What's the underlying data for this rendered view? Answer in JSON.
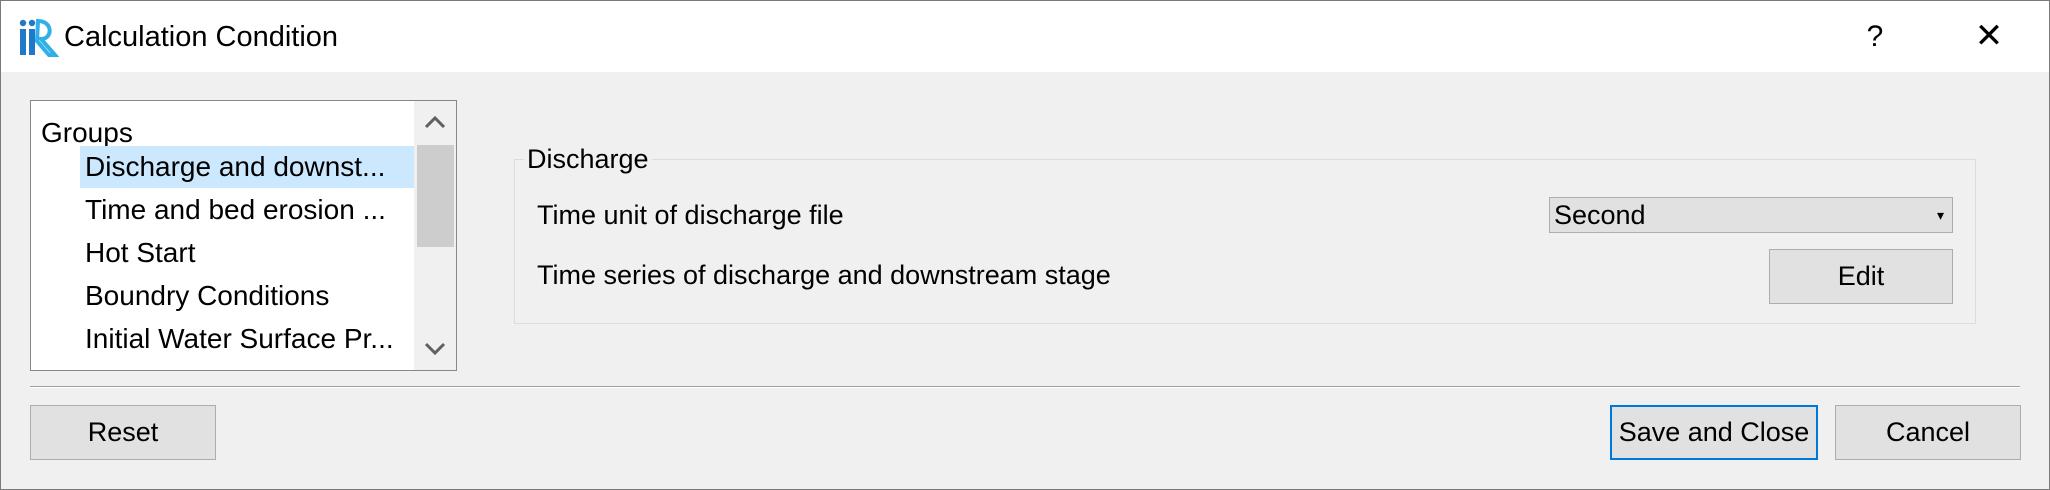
{
  "window": {
    "title": "Calculation Condition",
    "help_label": "?",
    "close_label": "✕",
    "icon": "iric-app-icon"
  },
  "groups": {
    "root_label": "Groups",
    "items": [
      {
        "label": "Discharge and downst..."
      },
      {
        "label": "Time and bed erosion ..."
      },
      {
        "label": "Hot Start"
      },
      {
        "label": "Boundry Conditions"
      },
      {
        "label": "Initial Water Surface Pr..."
      }
    ],
    "selected_index": 0
  },
  "discharge_group": {
    "title": "Discharge",
    "time_unit_label": "Time unit of discharge file",
    "time_unit_value": "Second",
    "time_series_label": "Time series of discharge and downstream stage",
    "edit_label": "Edit"
  },
  "footer": {
    "reset_label": "Reset",
    "save_label": "Save and Close",
    "cancel_label": "Cancel"
  },
  "colors": {
    "selection": "#cce8ff",
    "default_button_border": "#0078d7",
    "dialog_background": "#f0f0f0",
    "button_background": "#e1e1e1"
  }
}
